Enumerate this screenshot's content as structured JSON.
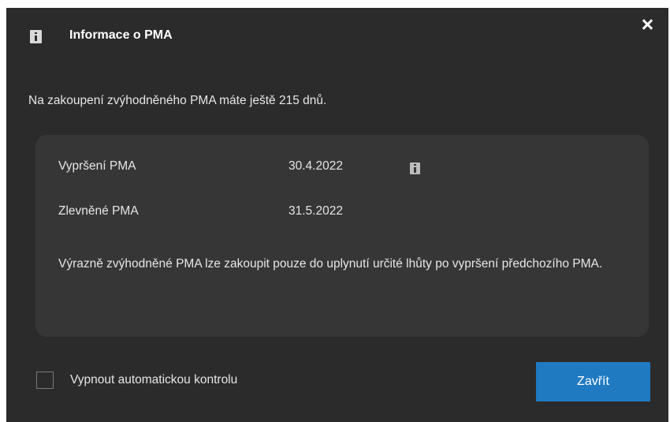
{
  "dialog": {
    "title": "Informace o PMA",
    "icon": "info-icon",
    "close_icon": "close-icon"
  },
  "message": "Na zakoupení zvýhodněného PMA máte ještě 215 dnů.",
  "details": {
    "rows": [
      {
        "label": "Vypršení PMA",
        "value": "30.4.2022",
        "has_info_icon": true
      },
      {
        "label": "Zlevněné PMA",
        "value": "31.5.2022",
        "has_info_icon": false
      }
    ],
    "note": "Výrazně zvýhodněné PMA lze zakoupit pouze do uplynutí určité lhůty po vypršení předchozího PMA."
  },
  "footer": {
    "checkbox_label": "Vypnout automatickou kontrolu",
    "checkbox_checked": false,
    "close_button_label": "Zavřít"
  },
  "colors": {
    "background": "#2b2b2b",
    "panel": "#363636",
    "accent": "#1f7ac1"
  }
}
